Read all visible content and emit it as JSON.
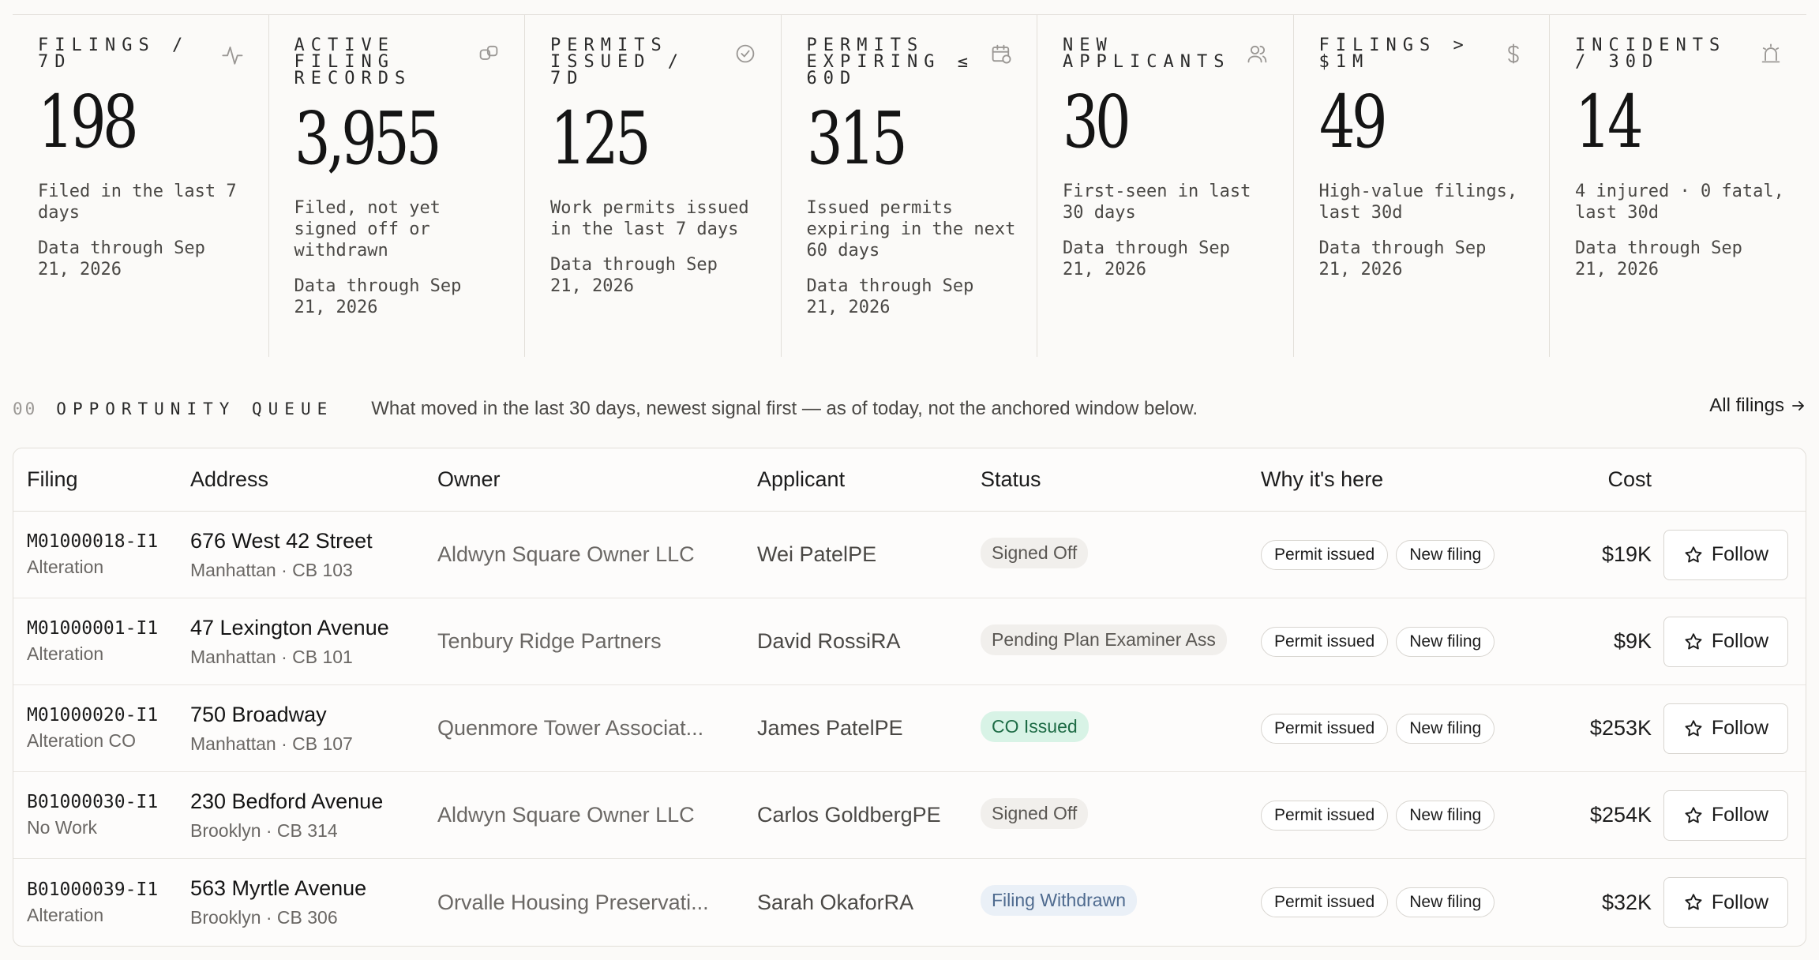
{
  "kpis": [
    {
      "label": "Filings / 7D",
      "icon": "activity-icon",
      "value": "198",
      "desc": "Filed in the last 7 days",
      "through": "Data through Sep 21, 2026"
    },
    {
      "label": "Active filing records",
      "icon": "link-icon",
      "value": "3,955",
      "desc": "Filed, not yet signed off or withdrawn",
      "through": "Data through Sep 21, 2026"
    },
    {
      "label": "Permits issued / 7D",
      "icon": "check-circle-icon",
      "value": "125",
      "desc": "Work permits issued in the last 7 days",
      "through": "Data through Sep 21, 2026"
    },
    {
      "label": "Permits expiring ≤ 60D",
      "icon": "calendar-clock-icon",
      "value": "315",
      "desc": "Issued permits expiring in the next 60 days",
      "through": "Data through Sep 21, 2026"
    },
    {
      "label": "New applicants",
      "icon": "users-icon",
      "value": "30",
      "desc": "First-seen in last 30 days",
      "through": "Data through Sep 21, 2026"
    },
    {
      "label": "Filings > $1M",
      "icon": "dollar-icon",
      "value": "49",
      "desc": "High-value filings, last 30d",
      "through": "Data through Sep 21, 2026"
    },
    {
      "label": "Incidents / 30D",
      "icon": "siren-icon",
      "value": "14",
      "desc": "4 injured · 0 fatal, last 30d",
      "through": "Data through Sep 21, 2026"
    }
  ],
  "queue": {
    "number": "00",
    "title": "OPPORTUNITY QUEUE",
    "subtitle": "What moved in the last 30 days, newest signal first — as of today, not the anchored window below.",
    "all_filings_label": "All filings"
  },
  "table": {
    "headers": {
      "filing": "Filing",
      "address": "Address",
      "owner": "Owner",
      "applicant": "Applicant",
      "status": "Status",
      "why": "Why it's here",
      "cost": "Cost"
    },
    "follow_label": "Follow",
    "rows": [
      {
        "id": "M01000018-I1",
        "type": "Alteration",
        "address": "676 West 42 Street",
        "area": "Manhattan · CB 103",
        "owner": "Aldwyn Square Owner LLC",
        "applicant": "Wei Patel",
        "role": "PE",
        "status": "Signed Off",
        "status_kind": "neutral",
        "tags": [
          "Permit issued",
          "New filing"
        ],
        "cost": "$19K"
      },
      {
        "id": "M01000001-I1",
        "type": "Alteration",
        "address": "47 Lexington Avenue",
        "area": "Manhattan · CB 101",
        "owner": "Tenbury Ridge Partners",
        "applicant": "David Rossi",
        "role": "RA",
        "status": "Pending Plan Examiner Ass",
        "status_kind": "neutral",
        "tags": [
          "Permit issued",
          "New filing"
        ],
        "cost": "$9K"
      },
      {
        "id": "M01000020-I1",
        "type": "Alteration CO",
        "address": "750 Broadway",
        "area": "Manhattan · CB 107",
        "owner": "Quenmore Tower Associat...",
        "applicant": "James Patel",
        "role": "PE",
        "status": "CO Issued",
        "status_kind": "co",
        "tags": [
          "Permit issued",
          "New filing"
        ],
        "cost": "$253K"
      },
      {
        "id": "B01000030-I1",
        "type": "No Work",
        "address": "230 Bedford Avenue",
        "area": "Brooklyn · CB 314",
        "owner": "Aldwyn Square Owner LLC",
        "applicant": "Carlos Goldberg",
        "role": "PE",
        "status": "Signed Off",
        "status_kind": "neutral",
        "tags": [
          "Permit issued",
          "New filing"
        ],
        "cost": "$254K"
      },
      {
        "id": "B01000039-I1",
        "type": "Alteration",
        "address": "563 Myrtle Avenue",
        "area": "Brooklyn · CB 306",
        "owner": "Orvalle Housing Preservati...",
        "applicant": "Sarah Okafor",
        "role": "RA",
        "status": "Filing Withdrawn",
        "status_kind": "withdrawn",
        "tags": [
          "Permit issued",
          "New filing"
        ],
        "cost": "$32K"
      }
    ]
  }
}
